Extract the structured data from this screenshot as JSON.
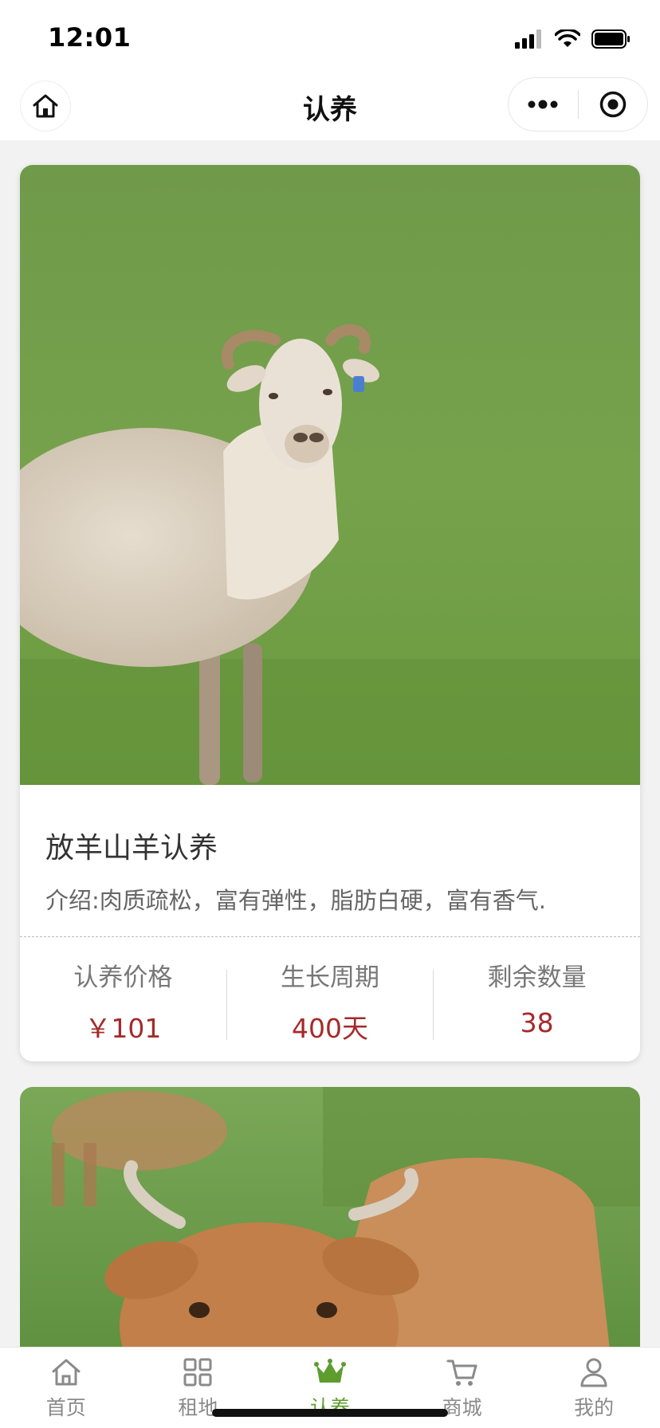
{
  "status_bar": {
    "time": "12:01"
  },
  "nav": {
    "title": "认养"
  },
  "adoption_card": {
    "photo": "sheep-on-grass",
    "title": "放羊山羊认养",
    "description": "介绍:肉质疏松，富有弹性，脂肪白硬，富有香气.",
    "stats": [
      {
        "label": "认养价格",
        "value": "￥101"
      },
      {
        "label": "生长周期",
        "value": "400天"
      },
      {
        "label": "剩余数量",
        "value": "38"
      }
    ]
  },
  "second_card": {
    "photo": "cattle-on-grass"
  },
  "tabs": [
    {
      "label": "首页",
      "icon": "home-icon"
    },
    {
      "label": "租地",
      "icon": "grid-icon"
    },
    {
      "label": "认养",
      "icon": "crown-icon",
      "active": true
    },
    {
      "label": "商城",
      "icon": "cart-icon"
    },
    {
      "label": "我的",
      "icon": "user-icon"
    }
  ],
  "colors": {
    "price_red": "#a52a2a",
    "active_green": "#5f9c2e",
    "grass": "#6e9e48"
  }
}
